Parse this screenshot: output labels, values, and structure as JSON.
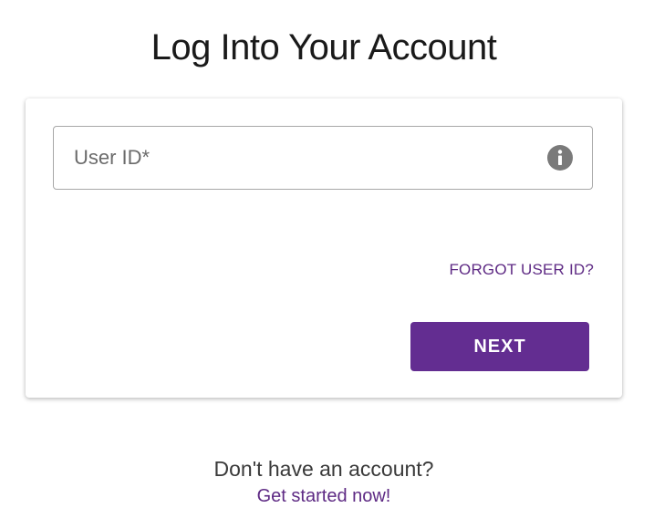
{
  "header": {
    "title": "Log Into Your Account"
  },
  "login_form": {
    "user_id_placeholder": "User ID*",
    "user_id_value": "",
    "info_icon": "info-icon",
    "forgot_label": "FORGOT USER ID?",
    "next_label": "NEXT"
  },
  "footer": {
    "prompt": "Don't have an account?",
    "signup_link": "Get started now!"
  },
  "colors": {
    "brand_purple": "#632d91",
    "link_purple": "#5e2a84",
    "icon_gray": "#7a7a7a",
    "field_border": "#a7a7a7"
  }
}
